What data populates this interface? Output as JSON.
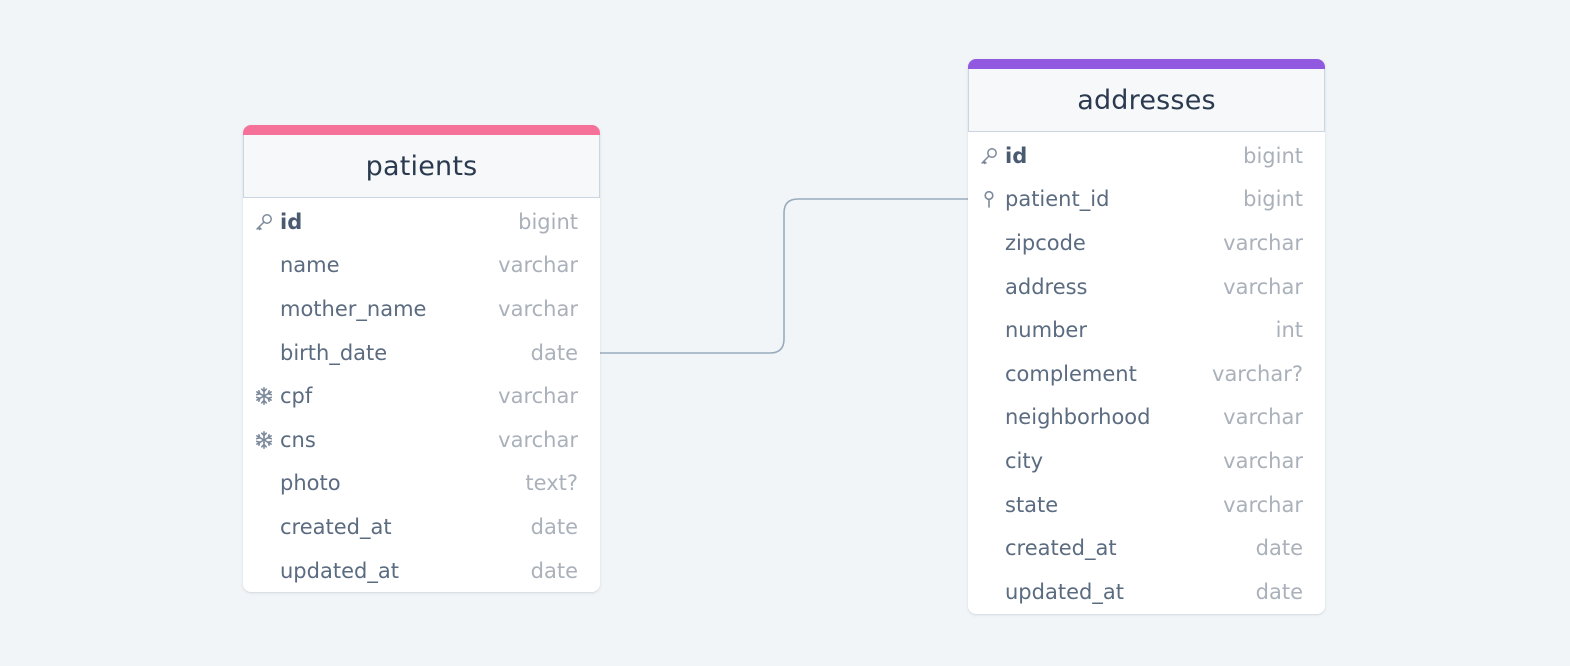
{
  "colors": {
    "background": "#f1f5f8",
    "patients_accent": "#f6719a",
    "addresses_accent": "#9159e0",
    "connector": "#9aabbe"
  },
  "relationship": {
    "from": "patients.id",
    "to": "addresses.patient_id"
  },
  "tables": [
    {
      "id": "patients",
      "name": "patients",
      "accent": "#f6719a",
      "columns": [
        {
          "name": "id",
          "type": "bigint",
          "icon": "key-icon",
          "primary": true
        },
        {
          "name": "name",
          "type": "varchar",
          "icon": null,
          "primary": false
        },
        {
          "name": "mother_name",
          "type": "varchar",
          "icon": null,
          "primary": false
        },
        {
          "name": "birth_date",
          "type": "date",
          "icon": null,
          "primary": false
        },
        {
          "name": "cpf",
          "type": "varchar",
          "icon": "unique-snowflake-icon",
          "primary": false
        },
        {
          "name": "cns",
          "type": "varchar",
          "icon": "unique-snowflake-icon",
          "primary": false
        },
        {
          "name": "photo",
          "type": "text?",
          "icon": null,
          "primary": false
        },
        {
          "name": "created_at",
          "type": "date",
          "icon": null,
          "primary": false
        },
        {
          "name": "updated_at",
          "type": "date",
          "icon": null,
          "primary": false
        }
      ]
    },
    {
      "id": "addresses",
      "name": "addresses",
      "accent": "#9159e0",
      "columns": [
        {
          "name": "id",
          "type": "bigint",
          "icon": "key-icon",
          "primary": true
        },
        {
          "name": "patient_id",
          "type": "bigint",
          "icon": "foreign-key-pin-icon",
          "primary": false
        },
        {
          "name": "zipcode",
          "type": "varchar",
          "icon": null,
          "primary": false
        },
        {
          "name": "address",
          "type": "varchar",
          "icon": null,
          "primary": false
        },
        {
          "name": "number",
          "type": "int",
          "icon": null,
          "primary": false
        },
        {
          "name": "complement",
          "type": "varchar?",
          "icon": null,
          "primary": false
        },
        {
          "name": "neighborhood",
          "type": "varchar",
          "icon": null,
          "primary": false
        },
        {
          "name": "city",
          "type": "varchar",
          "icon": null,
          "primary": false
        },
        {
          "name": "state",
          "type": "varchar",
          "icon": null,
          "primary": false
        },
        {
          "name": "created_at",
          "type": "date",
          "icon": null,
          "primary": false
        },
        {
          "name": "updated_at",
          "type": "date",
          "icon": null,
          "primary": false
        }
      ]
    }
  ]
}
